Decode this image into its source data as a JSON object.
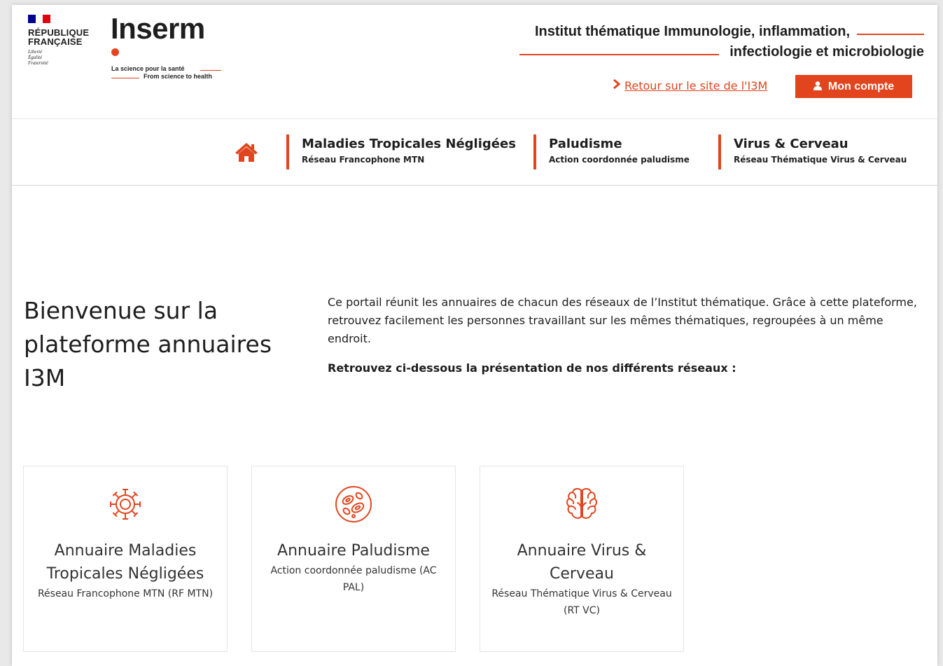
{
  "colors": {
    "accent": "#e2451e",
    "flag_blue": "#000091",
    "flag_red": "#e1000f",
    "text": "#1e1e1e"
  },
  "header": {
    "rf_title_line1": "RÉPUBLIQUE",
    "rf_title_line2": "FRANÇAISE",
    "rf_motto_1": "Liberté",
    "rf_motto_2": "Égalité",
    "rf_motto_3": "Fraternité",
    "brand": "Inserm",
    "tagline_fr": "La science pour la santé",
    "tagline_en": "From science to health",
    "institute_line1": "Institut thématique Immunologie, inflammation,",
    "institute_line2": "infectiologie et microbiologie",
    "back_link": "Retour sur le site de l'I3M",
    "account_button": "Mon compte"
  },
  "nav": {
    "home_icon": "home-icon",
    "items": [
      {
        "title": "Maladies Tropicales Négligées",
        "subtitle": "Réseau Francophone MTN"
      },
      {
        "title": "Paludisme",
        "subtitle": "Action coordonnée paludisme"
      },
      {
        "title": "Virus & Cerveau",
        "subtitle": "Réseau Thématique Virus & Cerveau"
      }
    ]
  },
  "main": {
    "welcome_title": "Bienvenue sur la plateforme annuaires I3M",
    "intro": "Ce portail réunit les annuaires de chacun des réseaux de l’Institut thématique. Grâce à cette plateforme, retrouvez facilement les personnes travaillant sur les mêmes thématiques, regroupées à un même endroit.",
    "intro_bold": "Retrouvez ci-dessous la présentation de nos différents réseaux :",
    "cards": [
      {
        "icon": "virus-icon",
        "title": "Annuaire Maladies Tropicales Négligées",
        "subtitle": "Réseau Francophone MTN (RF MTN)"
      },
      {
        "icon": "cells-icon",
        "title": "Annuaire Paludisme",
        "subtitle": "Action coordonnée paludisme (AC PAL)"
      },
      {
        "icon": "brain-icon",
        "title": "Annuaire Virus & Cerveau",
        "subtitle": "Réseau Thématique Virus & Cerveau (RT VC)"
      }
    ]
  }
}
